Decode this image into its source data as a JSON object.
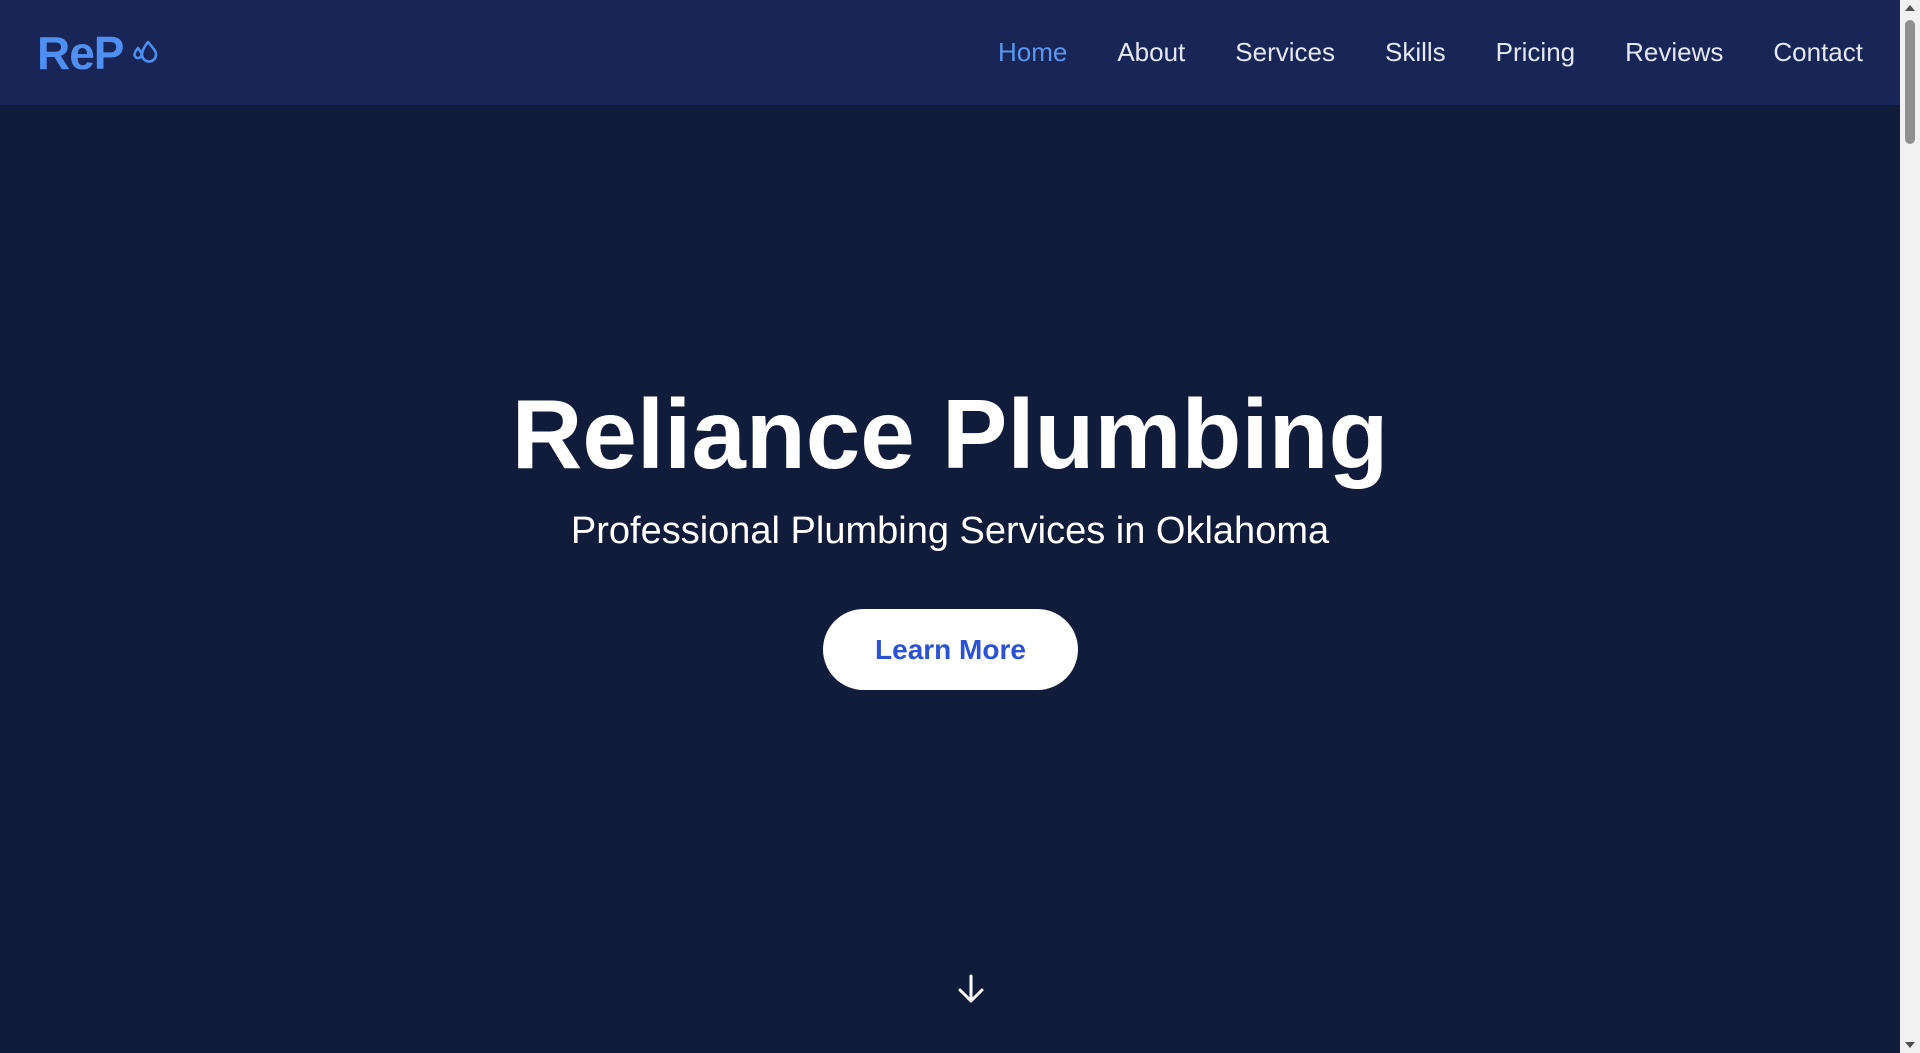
{
  "header": {
    "brand_text": "ReP",
    "brand_icon": "water-drops-icon",
    "nav": [
      {
        "label": "Home",
        "active": true
      },
      {
        "label": "About",
        "active": false
      },
      {
        "label": "Services",
        "active": false
      },
      {
        "label": "Skills",
        "active": false
      },
      {
        "label": "Pricing",
        "active": false
      },
      {
        "label": "Reviews",
        "active": false
      },
      {
        "label": "Contact",
        "active": false
      }
    ]
  },
  "hero": {
    "title": "Reliance Plumbing",
    "subtitle": "Professional Plumbing Services in Oklahoma",
    "cta_label": "Learn More",
    "scroll_icon": "arrow-down-icon"
  },
  "colors": {
    "background": "#111b3a",
    "navbar": "#182556",
    "accent": "#4e8ff1",
    "cta_text": "#2a52d3",
    "text": "#ffffff"
  }
}
